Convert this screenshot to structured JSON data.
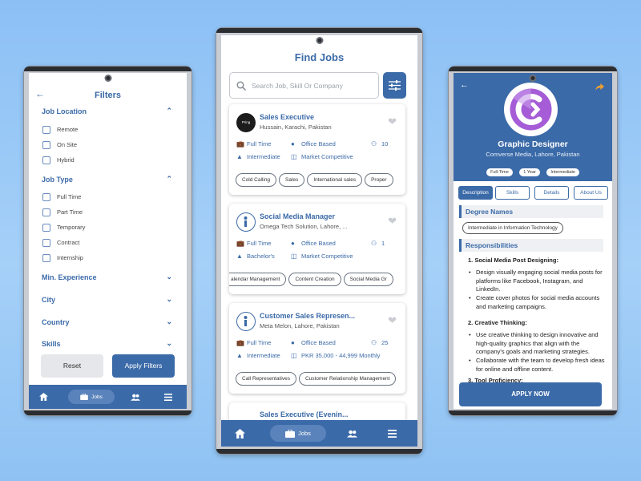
{
  "filters": {
    "title": "Filters",
    "sections": [
      {
        "label": "Job Location",
        "expanded": true,
        "options": [
          "Remote",
          "On Site",
          "Hybrid"
        ]
      },
      {
        "label": "Job Type",
        "expanded": true,
        "options": [
          "Full Time",
          "Part Time",
          "Temporary",
          "Contract",
          "Internship"
        ]
      },
      {
        "label": "Min. Experience",
        "expanded": false
      },
      {
        "label": "City",
        "expanded": false
      },
      {
        "label": "Country",
        "expanded": false
      },
      {
        "label": "Skills",
        "expanded": false
      }
    ],
    "reset_label": "Reset",
    "apply_label": "Apply Filters",
    "nav_jobs_label": "Jobs"
  },
  "jobs": {
    "title": "Find Jobs",
    "search_placeholder": "Search Job, Skill Or Company",
    "nav_jobs_label": "Jobs",
    "cards": [
      {
        "logo_text": "Pring",
        "title": "Sales Executive",
        "company": "Hussain, Karachi, Pakistan",
        "job_type": "Full Time",
        "location_type": "Office Based",
        "openings": "10",
        "level": "Intermediate",
        "salary": "Market Competitive",
        "skills": [
          "Cold Calling",
          "Sales",
          "International sales",
          "Proper"
        ]
      },
      {
        "title": "Social Media Manager",
        "company": "Omega Tech Solution, Lahore, ...",
        "job_type": "Full Time",
        "location_type": "Office Based",
        "openings": "1",
        "level": "Bachelor's",
        "salary": "Market Competitive",
        "skills": [
          "alendar Management",
          "Content Creation",
          "Social Media Gr"
        ]
      },
      {
        "title": "Customer Sales Represen...",
        "company": "Meta Melon, Lahore, Pakistan",
        "job_type": "Full Time",
        "location_type": "Office Based",
        "openings": "25",
        "level": "Intermediate",
        "salary": "PKR 35,000 - 44,999 Monthly",
        "skills": [
          "Call Representatives",
          "Customer Relationship Management"
        ]
      },
      {
        "title": "Sales Executive (Evenin..."
      }
    ]
  },
  "detail": {
    "title": "Graphic Designer",
    "company": "Comverse Media, Lahore, Pakistan",
    "badges": [
      "Full-Time",
      "1 Year",
      "Intermediate"
    ],
    "tabs": [
      "Description",
      "Skills",
      "Details",
      "About Us"
    ],
    "degree_heading": "Degree Names",
    "degree": "Intermediate in Information Technology",
    "resp_heading": "Responsibilities",
    "items": [
      {
        "heading": "1. Social Media Post Designing:",
        "bullets": [
          "Design visually engaging social media posts for platforms like Facebook, Instagram, and LinkedIn.",
          "Create cover photos for social media accounts and marketing campaigns."
        ]
      },
      {
        "heading": "2. Creative Thinking:",
        "bullets": [
          "Use creative thinking to design innovative and high-quality graphics that align with the company's goals and marketing strategies.",
          "Collaborate with the team to develop fresh ideas for online and offline content."
        ]
      },
      {
        "heading": "3. Tool Proficiency:"
      }
    ],
    "apply_label": "APPLY NOW"
  },
  "colors": {
    "primary": "#3b6aa8",
    "background": "#9ccbf7"
  }
}
